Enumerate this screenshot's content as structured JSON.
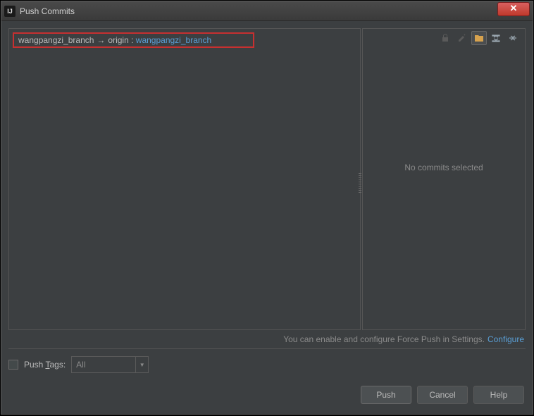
{
  "window": {
    "title": "Push Commits",
    "app_icon_text": "IJ"
  },
  "branch": {
    "local": "wangpangzi_branch",
    "arrow": "→",
    "origin_label": "origin :",
    "remote": "wangpangzi_branch"
  },
  "toolbar_icons": {
    "lock": "lock-icon",
    "edit": "edit-icon",
    "folder": "folder-icon",
    "expand": "expand-all-icon",
    "collapse": "collapse-all-icon"
  },
  "right_panel": {
    "empty_message": "No commits selected"
  },
  "hint": {
    "text": "You can enable and configure Force Push in Settings.",
    "link": "Configure"
  },
  "tags": {
    "checkbox_label_prefix": "Push ",
    "checkbox_label_underlined": "T",
    "checkbox_label_suffix": "ags:",
    "dropdown_value": "All"
  },
  "buttons": {
    "push": "Push",
    "cancel": "Cancel",
    "help": "Help"
  }
}
